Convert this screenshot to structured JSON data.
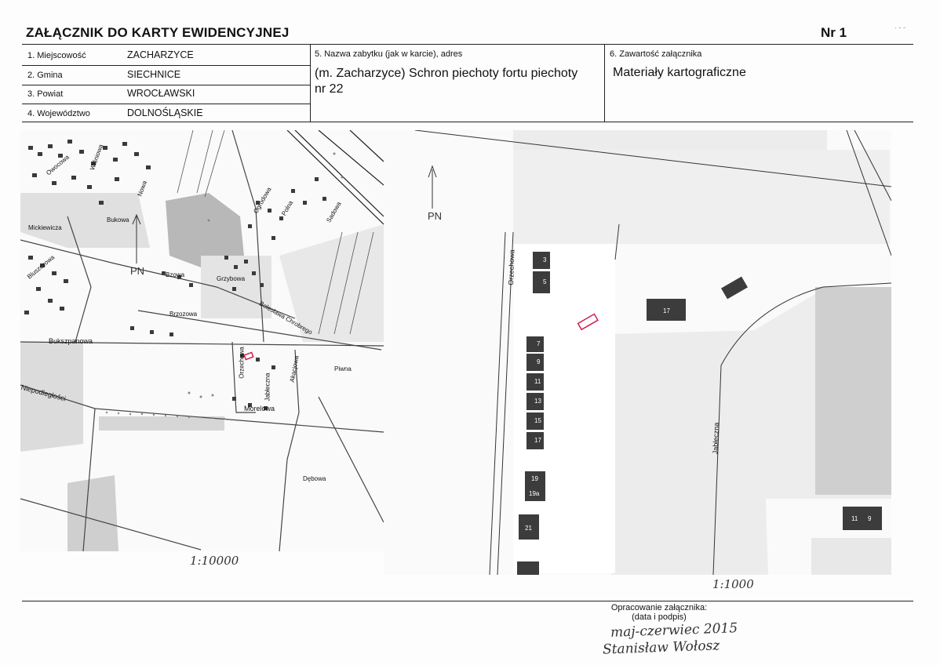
{
  "header": {
    "title": "ZAŁĄCZNIK DO KARTY EWIDENCYJNEJ",
    "number": "Nr 1"
  },
  "fields": [
    {
      "label": "1. Miejscowość",
      "value": "ZACHARZYCE"
    },
    {
      "label": "2. Gmina",
      "value": "SIECHNICE"
    },
    {
      "label": "3. Powiat",
      "value": "WROCŁAWSKI"
    },
    {
      "label": "4. Województwo",
      "value": "DOLNOŚLĄSKIE"
    }
  ],
  "monument": {
    "label": "5. Nazwa zabytku (jak w karcie), adres",
    "line1": "(m. Zacharzyce) Schron piechoty fortu piechoty",
    "line2": "nr 22"
  },
  "contents": {
    "label": "6. Zawartość załącznika",
    "value": "Materiały kartograficzne"
  },
  "map_left": {
    "scale": "1:10000",
    "north": "PN",
    "streets": [
      "Bukszpanowa",
      "Niepodległości",
      "Orzechowa",
      "Jabłeczna",
      "Akacjowa",
      "Morelowa",
      "Bolesława Chrobrego",
      "Bzowa",
      "Grzybowa",
      "Nowa",
      "Ogrodowa",
      "Polna",
      "Sadowa",
      "Bluszczowa",
      "Owocowa",
      "Wiśniowa",
      "Bukowa",
      "Mickiewicza",
      "Brzozowa",
      "Dębowa",
      "Piwna"
    ]
  },
  "map_right": {
    "scale": "1:1000",
    "north": "PN",
    "streets": [
      "Orzechowa",
      "Jabłeczna"
    ],
    "buildings": [
      "3",
      "5",
      "7",
      "9",
      "11",
      "13",
      "15",
      "17",
      "19",
      "19a",
      "21",
      "17",
      "11",
      "9"
    ]
  },
  "footer": {
    "prep_line1": "Opracowanie załącznika:",
    "prep_line2": "(data i podpis)",
    "sign_line1": "maj-czerwiec 2015",
    "sign_line2": "Stanisław Wołosz"
  }
}
